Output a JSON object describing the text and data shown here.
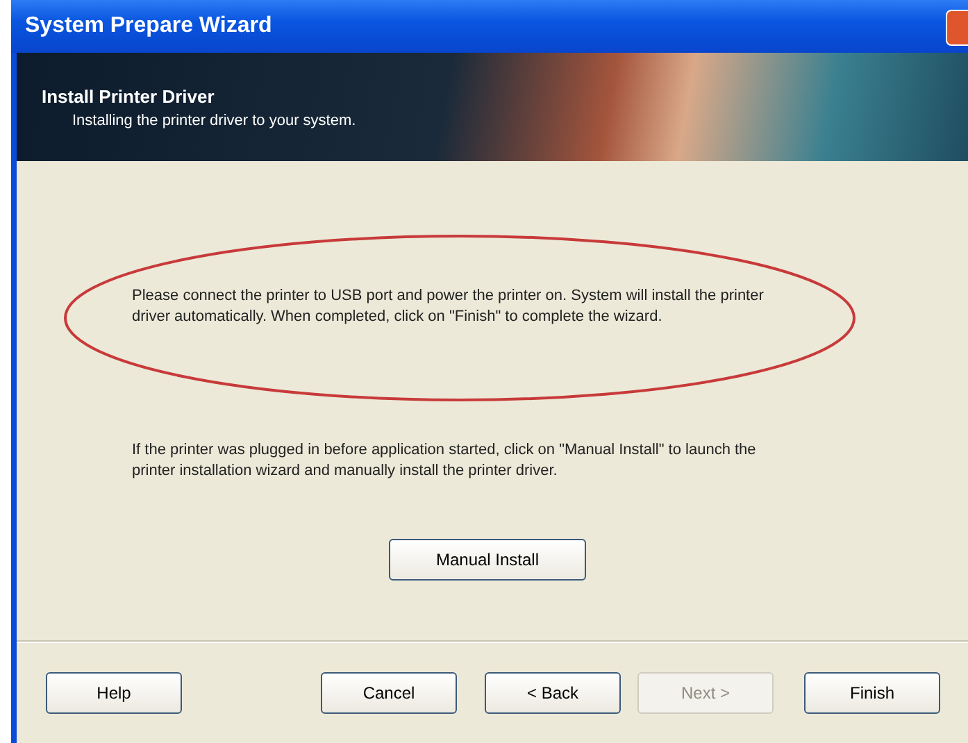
{
  "window": {
    "title": "System Prepare Wizard"
  },
  "header": {
    "title": "Install Printer Driver",
    "subtitle": "Installing the printer driver to your system."
  },
  "message": {
    "text": "Please connect the printer to USB port and power the printer on. System will install the printer driver automatically. When completed, click on \"Finish\" to complete the wizard.",
    "highlighted": true
  },
  "manual_note": "If the printer was plugged in before application started, click on \"Manual Install\" to launch the printer installation wizard and manually install the printer driver.",
  "manual_button": {
    "label": "Manual Install"
  },
  "buttons": [
    {
      "label": "Help",
      "disabled": false
    },
    {
      "label": "Cancel",
      "disabled": false
    },
    {
      "label": "< Back",
      "disabled": false
    },
    {
      "label": "Next >",
      "disabled": true
    },
    {
      "label": "Finish",
      "disabled": false
    }
  ]
}
